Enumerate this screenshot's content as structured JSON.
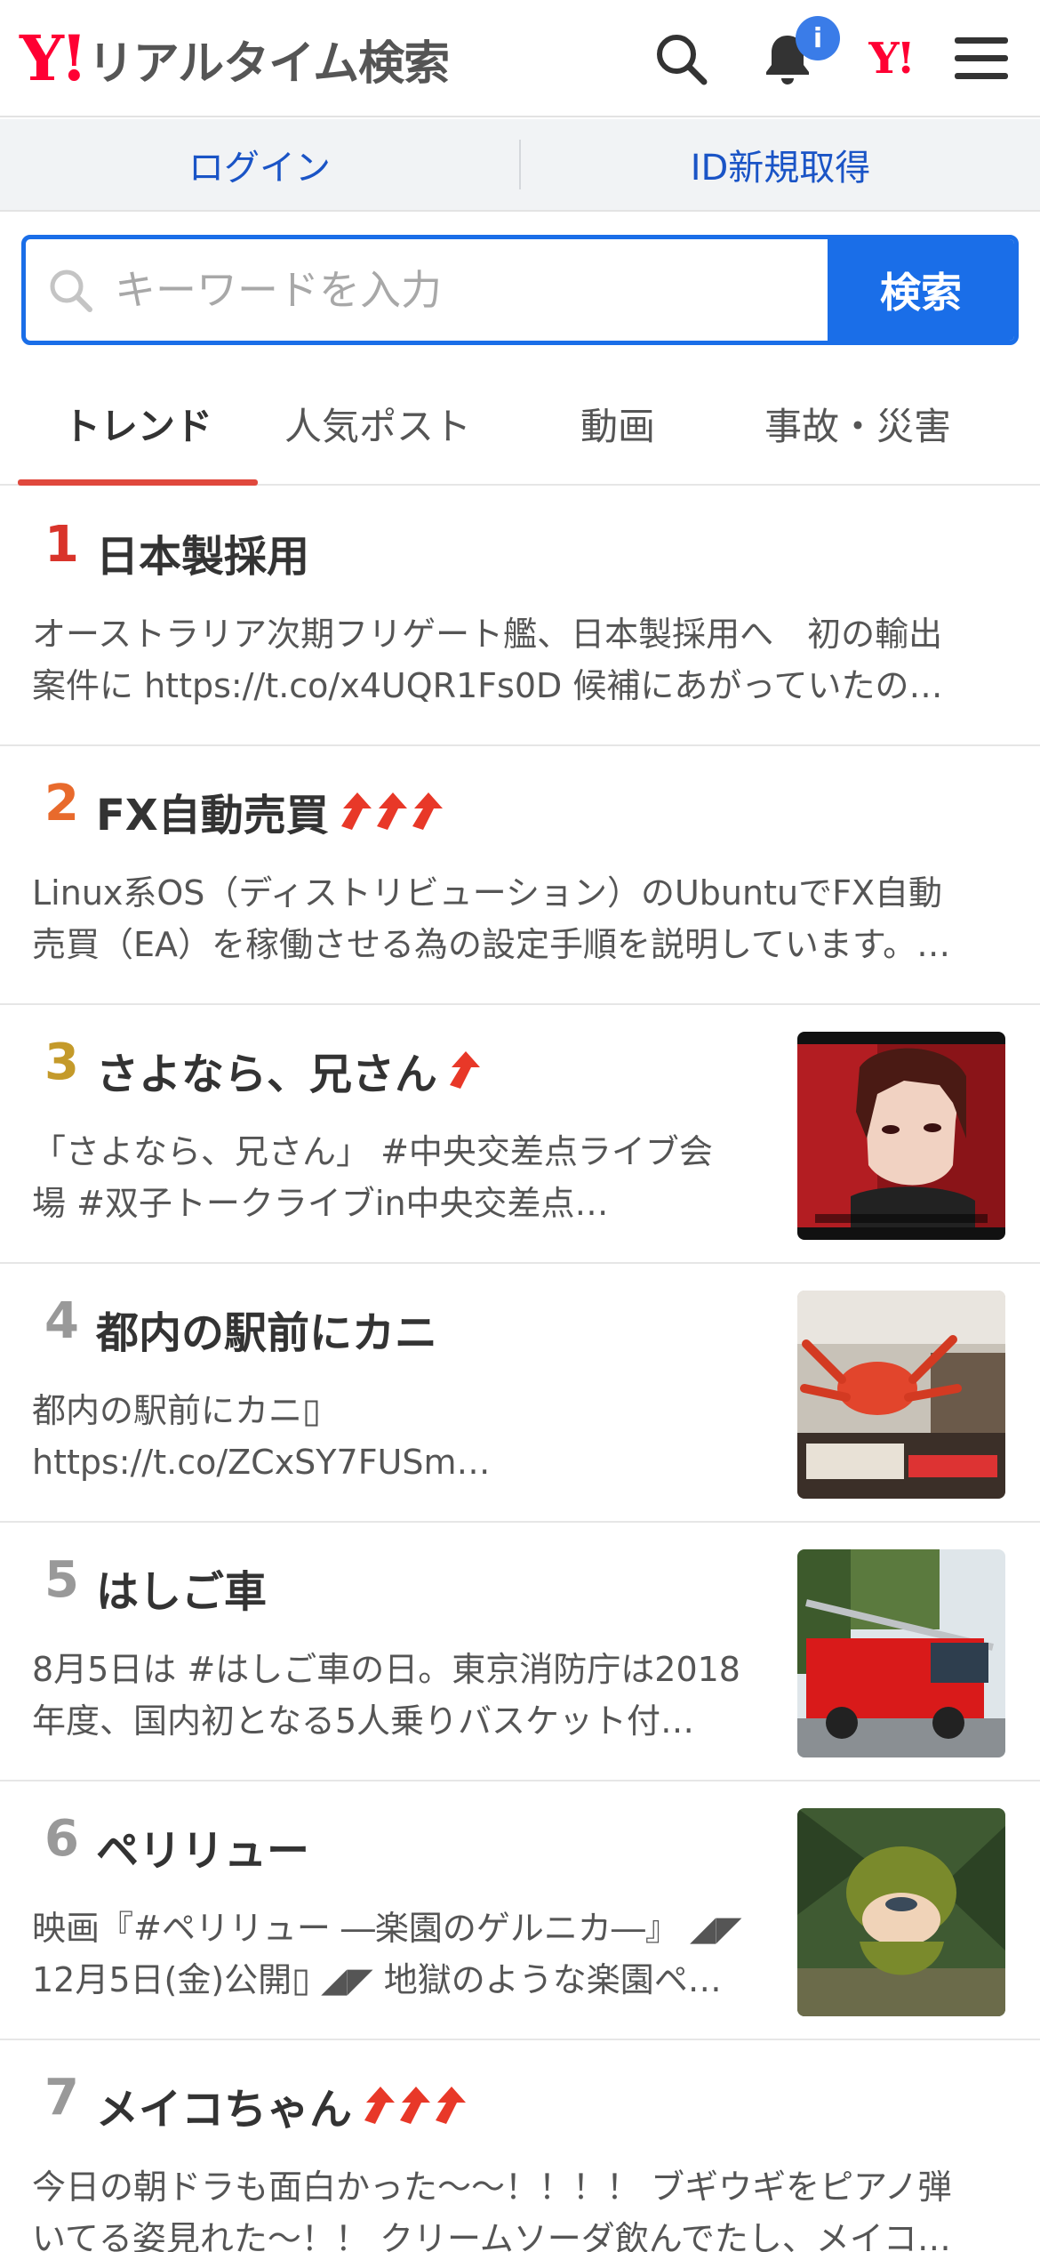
{
  "header": {
    "logo_mark": "Y!",
    "logo_text": "リアルタイム検索",
    "notification_badge": "i",
    "yj_mark": "Y!"
  },
  "loginbar": {
    "login": "ログイン",
    "signup": "ID新規取得"
  },
  "search": {
    "placeholder": "キーワードを入力",
    "button": "検索"
  },
  "tabs": [
    "トレンド",
    "人気ポスト",
    "動画",
    "事故・災害"
  ],
  "trends": [
    {
      "rank": "1",
      "rank_color": "#d9342b",
      "title": "日本製採用",
      "arrows": 0,
      "line1": "オーストラリア次期フリゲート艦、日本製採用へ　初の輸出",
      "line2": "案件に https://t.co/x4UQR1Fs0D 候補にあがっていたの…"
    },
    {
      "rank": "2",
      "rank_color": "#e86a2c",
      "title": "FX自動売買",
      "arrows": 3,
      "line1": "Linux系OS（ディストリビューション）のUbuntuでFX自動",
      "line2": "売買（EA）を稼働させる為の設定手順を説明しています。…"
    },
    {
      "rank": "3",
      "rank_color": "#c49a2a",
      "title": "さよなら、兄さん",
      "arrows": 1,
      "line1": "「さよなら、兄さん」 #中央交差点ライブ会",
      "line2": "場 #双子トークライブin中央交差点…"
    },
    {
      "rank": "4",
      "rank_color": "#999999",
      "title": "都内の駅前にカニ",
      "arrows": 0,
      "line1": "都内の駅前にカニ▯",
      "line2": "https://t.co/ZCxSY7FUSm…"
    },
    {
      "rank": "5",
      "rank_color": "#999999",
      "title": "はしご車",
      "arrows": 0,
      "line1": "8月5日は #はしご車の日。東京消防庁は2018",
      "line2": "年度、国内初となる5人乗りバスケット付…"
    },
    {
      "rank": "6",
      "rank_color": "#999999",
      "title": "ペリリュー",
      "arrows": 0,
      "line1": "映画『#ペリリュー ―楽園のゲルニカ―』 ◢◤",
      "line2": "12月5日(金)公開▯ ◢◤ 地獄のような楽園ペ…"
    },
    {
      "rank": "7",
      "rank_color": "#999999",
      "title": "メイコちゃん",
      "arrows": 3,
      "line1": "今日の朝ドラも面白かった〜〜！！！！ ブギウギをピアノ弾",
      "line2": "いてる姿見れた〜！！ クリームソーダ飲んでたし、メイコ…"
    }
  ],
  "thumb_images": [
    "anime-character-image",
    "crab-sign-image",
    "fire-truck-image",
    "soldier-figure-image"
  ]
}
